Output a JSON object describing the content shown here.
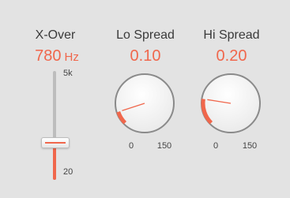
{
  "xover": {
    "label": "X-Over",
    "value": "780",
    "unit": "Hz",
    "scale_max": "5k",
    "scale_min": "20",
    "position_fraction": 0.33
  },
  "lo_spread": {
    "label": "Lo Spread",
    "value": "0.10",
    "scale_min": "0",
    "scale_max": "150",
    "fraction": 0.1
  },
  "hi_spread": {
    "label": "Hi Spread",
    "value": "0.20",
    "scale_min": "0",
    "scale_max": "150",
    "fraction": 0.2
  },
  "colors": {
    "accent": "#f0674c",
    "background": "#e3e3e3",
    "text": "#3a3a3a"
  }
}
